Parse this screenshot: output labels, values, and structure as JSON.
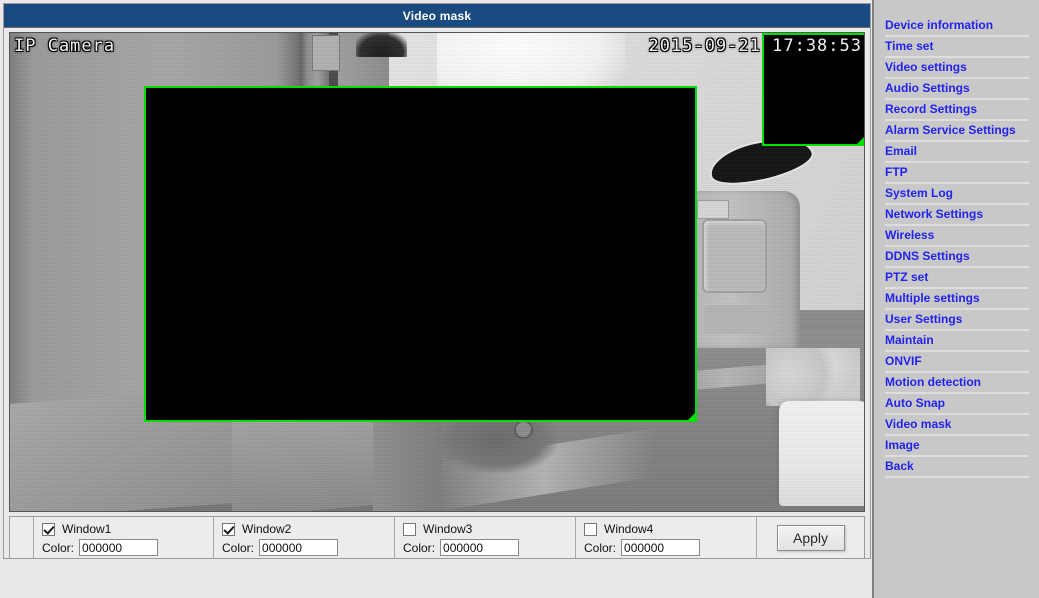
{
  "window": {
    "title": "Video mask"
  },
  "video": {
    "osd_name": "IP Camera",
    "osd_timestamp": "2015-09-21 17:38:53",
    "mask_border_color": "#00e000",
    "mask_fill_color": "#000000"
  },
  "controls": {
    "windows": [
      {
        "label": "Window1",
        "checked": true,
        "color_label": "Color:",
        "color_value": "000000"
      },
      {
        "label": "Window2",
        "checked": true,
        "color_label": "Color:",
        "color_value": "000000"
      },
      {
        "label": "Window3",
        "checked": false,
        "color_label": "Color:",
        "color_value": "000000"
      },
      {
        "label": "Window4",
        "checked": false,
        "color_label": "Color:",
        "color_value": "000000"
      }
    ],
    "apply_label": "Apply"
  },
  "sidebar": {
    "items": [
      {
        "label": "Device information"
      },
      {
        "label": "Time set"
      },
      {
        "label": "Video settings"
      },
      {
        "label": "Audio Settings"
      },
      {
        "label": "Record Settings"
      },
      {
        "label": "Alarm Service Settings"
      },
      {
        "label": "Email"
      },
      {
        "label": "FTP"
      },
      {
        "label": "System Log"
      },
      {
        "label": "Network Settings"
      },
      {
        "label": "Wireless"
      },
      {
        "label": "DDNS Settings"
      },
      {
        "label": "PTZ set"
      },
      {
        "label": "Multiple settings"
      },
      {
        "label": "User Settings"
      },
      {
        "label": "Maintain"
      },
      {
        "label": "ONVIF"
      },
      {
        "label": "Motion detection"
      },
      {
        "label": "Auto Snap"
      },
      {
        "label": "Video mask"
      },
      {
        "label": "Image"
      },
      {
        "label": "Back"
      }
    ],
    "link_color": "#2222ee"
  }
}
